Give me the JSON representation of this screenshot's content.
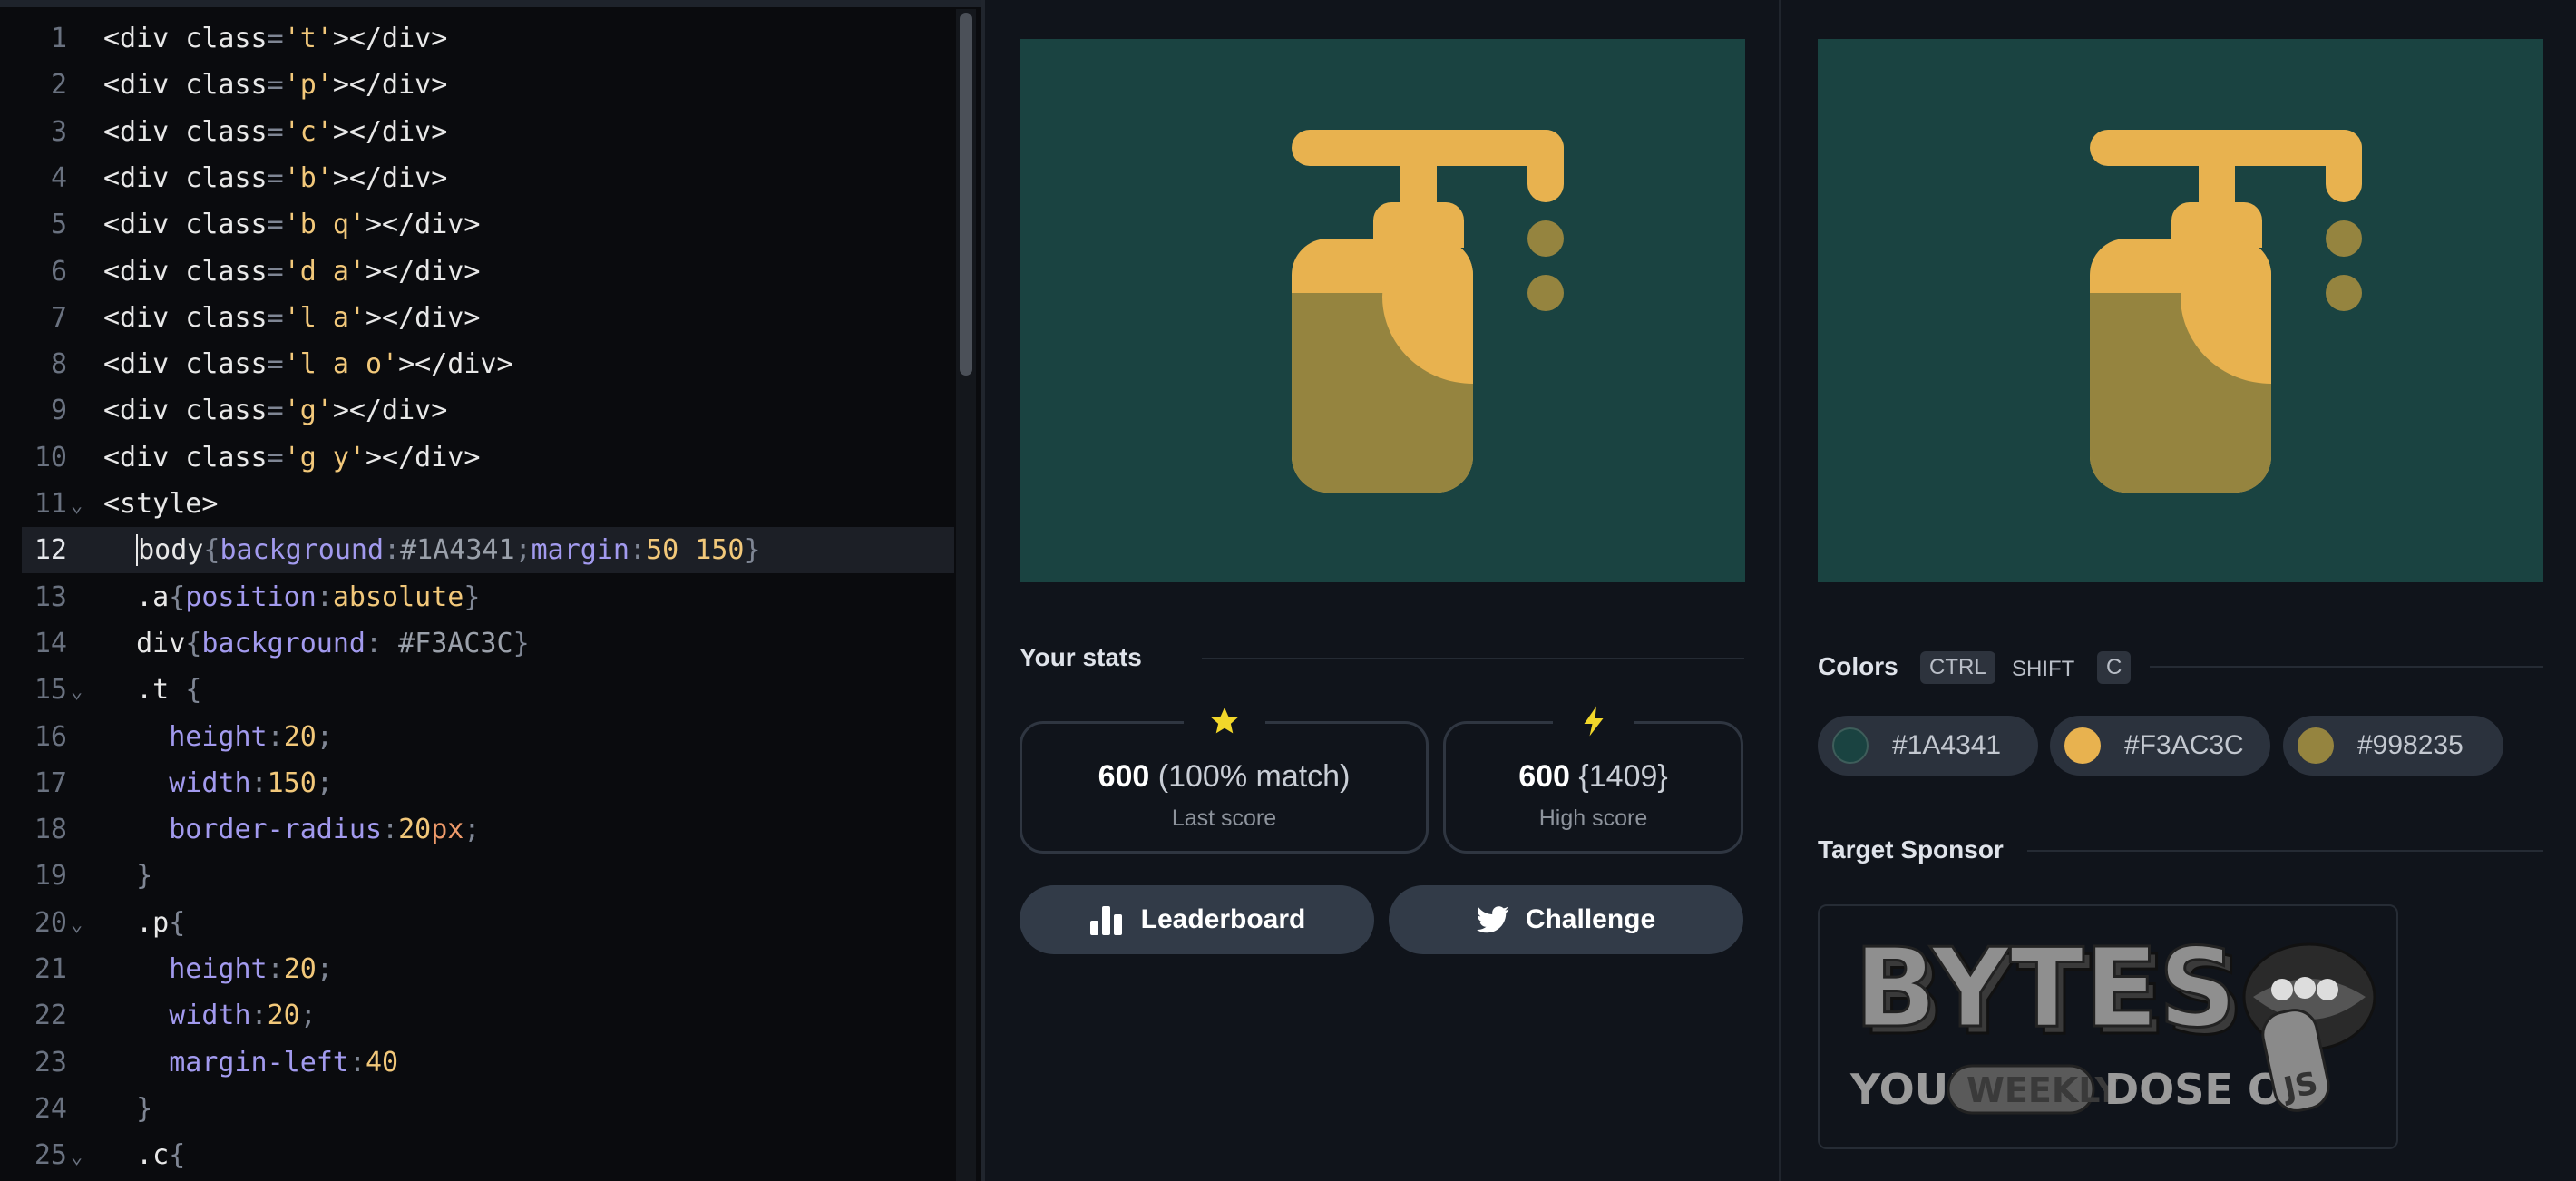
{
  "editor": {
    "lines": [
      {
        "n": "1",
        "tokens": [
          [
            "tg",
            "<div "
          ],
          [
            "tg",
            "class"
          ],
          [
            "pu",
            "="
          ],
          [
            "st",
            "'t'"
          ],
          [
            "tg",
            "></div>"
          ]
        ]
      },
      {
        "n": "2",
        "tokens": [
          [
            "tg",
            "<div "
          ],
          [
            "tg",
            "class"
          ],
          [
            "pu",
            "="
          ],
          [
            "st",
            "'p'"
          ],
          [
            "tg",
            "></div>"
          ]
        ]
      },
      {
        "n": "3",
        "tokens": [
          [
            "tg",
            "<div "
          ],
          [
            "tg",
            "class"
          ],
          [
            "pu",
            "="
          ],
          [
            "st",
            "'c'"
          ],
          [
            "tg",
            "></div>"
          ]
        ]
      },
      {
        "n": "4",
        "tokens": [
          [
            "tg",
            "<div "
          ],
          [
            "tg",
            "class"
          ],
          [
            "pu",
            "="
          ],
          [
            "st",
            "'b'"
          ],
          [
            "tg",
            "></div>"
          ]
        ]
      },
      {
        "n": "5",
        "tokens": [
          [
            "tg",
            "<div "
          ],
          [
            "tg",
            "class"
          ],
          [
            "pu",
            "="
          ],
          [
            "st",
            "'b q'"
          ],
          [
            "tg",
            "></div>"
          ]
        ]
      },
      {
        "n": "6",
        "tokens": [
          [
            "tg",
            "<div "
          ],
          [
            "tg",
            "class"
          ],
          [
            "pu",
            "="
          ],
          [
            "st",
            "'d a'"
          ],
          [
            "tg",
            "></div>"
          ]
        ]
      },
      {
        "n": "7",
        "tokens": [
          [
            "tg",
            "<div "
          ],
          [
            "tg",
            "class"
          ],
          [
            "pu",
            "="
          ],
          [
            "st",
            "'l a'"
          ],
          [
            "tg",
            "></div>"
          ]
        ]
      },
      {
        "n": "8",
        "tokens": [
          [
            "tg",
            "<div "
          ],
          [
            "tg",
            "class"
          ],
          [
            "pu",
            "="
          ],
          [
            "st",
            "'l a o'"
          ],
          [
            "tg",
            "></div>"
          ]
        ]
      },
      {
        "n": "9",
        "tokens": [
          [
            "tg",
            "<div "
          ],
          [
            "tg",
            "class"
          ],
          [
            "pu",
            "="
          ],
          [
            "st",
            "'g'"
          ],
          [
            "tg",
            "></div>"
          ]
        ]
      },
      {
        "n": "10",
        "tokens": [
          [
            "tg",
            "<div "
          ],
          [
            "tg",
            "class"
          ],
          [
            "pu",
            "="
          ],
          [
            "st",
            "'g y'"
          ],
          [
            "tg",
            "></div>"
          ]
        ]
      },
      {
        "n": "11",
        "fold": true,
        "tokens": [
          [
            "tg",
            "<style>"
          ]
        ]
      },
      {
        "n": "12",
        "active": true,
        "tokens": [
          [
            "tg",
            "  "
          ],
          [
            "cur",
            ""
          ],
          [
            "tg",
            "body"
          ],
          [
            "pu",
            "{"
          ],
          [
            "pr",
            "background"
          ],
          [
            "pu",
            ":"
          ],
          [
            "hx",
            "#1A4341"
          ],
          [
            "pu",
            ";"
          ],
          [
            "pr",
            "margin"
          ],
          [
            "pu",
            ":"
          ],
          [
            "nm",
            "50 150"
          ],
          [
            "pu",
            "}"
          ]
        ]
      },
      {
        "n": "13",
        "tokens": [
          [
            "tg",
            "  .a"
          ],
          [
            "pu",
            "{"
          ],
          [
            "pr",
            "position"
          ],
          [
            "pu",
            ":"
          ],
          [
            "nm",
            "absolute"
          ],
          [
            "pu",
            "}"
          ]
        ]
      },
      {
        "n": "14",
        "tokens": [
          [
            "tg",
            "  div"
          ],
          [
            "pu",
            "{"
          ],
          [
            "pr",
            "background"
          ],
          [
            "pu",
            ": "
          ],
          [
            "hx",
            "#F3AC3C"
          ],
          [
            "pu",
            "}"
          ]
        ]
      },
      {
        "n": "15",
        "fold": true,
        "tokens": [
          [
            "tg",
            "  .t "
          ],
          [
            "pu",
            "{"
          ]
        ]
      },
      {
        "n": "16",
        "tokens": [
          [
            "tg",
            "    "
          ],
          [
            "pr",
            "height"
          ],
          [
            "pu",
            ":"
          ],
          [
            "nm",
            "20"
          ],
          [
            "pu",
            ";"
          ]
        ]
      },
      {
        "n": "17",
        "tokens": [
          [
            "tg",
            "    "
          ],
          [
            "pr",
            "width"
          ],
          [
            "pu",
            ":"
          ],
          [
            "nm",
            "150"
          ],
          [
            "pu",
            ";"
          ]
        ]
      },
      {
        "n": "18",
        "tokens": [
          [
            "tg",
            "    "
          ],
          [
            "pr",
            "border-radius"
          ],
          [
            "pu",
            ":"
          ],
          [
            "nm",
            "20"
          ],
          [
            "un",
            "px"
          ],
          [
            "pu",
            ";"
          ]
        ]
      },
      {
        "n": "19",
        "tokens": [
          [
            "tg",
            "  "
          ],
          [
            "pu",
            "}"
          ]
        ]
      },
      {
        "n": "20",
        "fold": true,
        "tokens": [
          [
            "tg",
            "  .p"
          ],
          [
            "pu",
            "{"
          ]
        ]
      },
      {
        "n": "21",
        "tokens": [
          [
            "tg",
            "    "
          ],
          [
            "pr",
            "height"
          ],
          [
            "pu",
            ":"
          ],
          [
            "nm",
            "20"
          ],
          [
            "pu",
            ";"
          ]
        ]
      },
      {
        "n": "22",
        "tokens": [
          [
            "tg",
            "    "
          ],
          [
            "pr",
            "width"
          ],
          [
            "pu",
            ":"
          ],
          [
            "nm",
            "20"
          ],
          [
            "pu",
            ";"
          ]
        ]
      },
      {
        "n": "23",
        "tokens": [
          [
            "tg",
            "    "
          ],
          [
            "pr",
            "margin-left"
          ],
          [
            "pu",
            ":"
          ],
          [
            "nm",
            "40"
          ]
        ]
      },
      {
        "n": "24",
        "tokens": [
          [
            "tg",
            "  "
          ],
          [
            "pu",
            "}"
          ]
        ]
      },
      {
        "n": "25",
        "fold": true,
        "tokens": [
          [
            "tg",
            "  .c"
          ],
          [
            "pu",
            "{"
          ]
        ]
      }
    ]
  },
  "stats": {
    "title": "Your stats",
    "last": {
      "score": "600",
      "detail": "(100% match)",
      "label": "Last score",
      "icon": "star-icon"
    },
    "high": {
      "score": "600",
      "detail": "{1409}",
      "label": "High score",
      "icon": "bolt-icon"
    }
  },
  "buttons": {
    "leaderboard": "Leaderboard",
    "challenge": "Challenge"
  },
  "colors": {
    "title": "Colors",
    "shortcut": {
      "ctrl": "CTRL",
      "shift": "SHIFT",
      "key": "C"
    },
    "swatches": [
      {
        "hex": "#1A4341",
        "color": "#1a4341"
      },
      {
        "hex": "#F3AC3C",
        "color": "#e8b24f"
      },
      {
        "hex": "#998235",
        "color": "#95843f"
      }
    ]
  },
  "sponsor": {
    "title": "Target Sponsor",
    "brand": "BYTES",
    "tag_your": "YOUR",
    "tag_weekly": "WEEKLY",
    "tag_dose": "DOSE OF",
    "tag_js": "JS"
  },
  "palette": {
    "bg": "#1a4341",
    "orange": "#e8b24f",
    "olive": "#95843f"
  }
}
